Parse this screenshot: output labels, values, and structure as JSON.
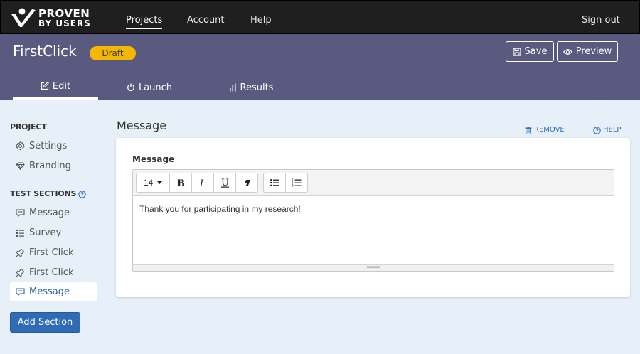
{
  "nav": {
    "logo_line1": "PROVEN",
    "logo_line2": "BY USERS",
    "projects": "Projects",
    "account": "Account",
    "help": "Help",
    "signout": "Sign out"
  },
  "project": {
    "title": "FirstClick",
    "status": "Draft",
    "save_label": "Save",
    "preview_label": "Preview"
  },
  "tabs": [
    {
      "label": "Edit",
      "icon": "edit-icon",
      "active": true
    },
    {
      "label": "Launch",
      "icon": "power-icon",
      "active": false
    },
    {
      "label": "Results",
      "icon": "bar-chart-icon",
      "active": false
    }
  ],
  "sidebar": {
    "project_heading": "PROJECT",
    "project_items": [
      {
        "label": "Settings",
        "icon": "gear-icon"
      },
      {
        "label": "Branding",
        "icon": "diamond-icon"
      }
    ],
    "sections_heading": "TEST SECTIONS",
    "section_items": [
      {
        "label": "Message",
        "icon": "message-icon",
        "active": false
      },
      {
        "label": "Survey",
        "icon": "list-icon",
        "active": false
      },
      {
        "label": "First Click",
        "icon": "pin-icon",
        "active": false
      },
      {
        "label": "First Click",
        "icon": "pin-icon",
        "active": false
      },
      {
        "label": "Message",
        "icon": "message-icon",
        "active": true
      }
    ],
    "add_section": "Add Section"
  },
  "main": {
    "section_title": "Message",
    "remove_label": "REMOVE",
    "help_label": "HELP",
    "field_label": "Message",
    "font_size": "14",
    "content": "Thank you for participating in my research!"
  },
  "colors": {
    "topbar": "#1f1f1f",
    "header": "#5a5a80",
    "draft": "#f5b800",
    "accent": "#2f6cb5",
    "background": "#e7f0f8"
  }
}
